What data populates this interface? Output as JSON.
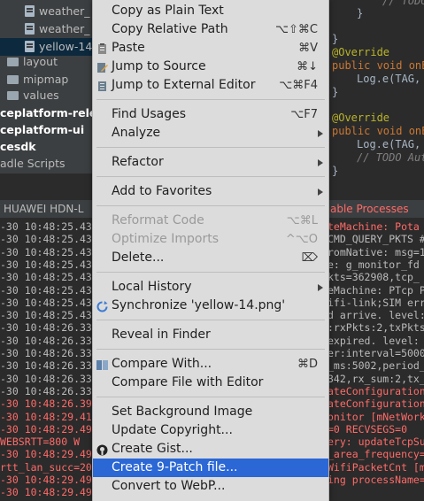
{
  "tree": {
    "items": [
      {
        "label": "weather_",
        "icon": "file-icon"
      },
      {
        "label": "weather_",
        "icon": "file-icon"
      },
      {
        "label": "yellow-14",
        "icon": "file-icon",
        "selected": true
      },
      {
        "label": "layout",
        "icon": "folder-icon"
      },
      {
        "label": "mipmap",
        "icon": "folder-icon"
      },
      {
        "label": "values",
        "icon": "folder-icon"
      },
      {
        "label": "ceplatform-rele",
        "icon": "module"
      },
      {
        "label": "ceplatform-ui",
        "icon": "module"
      },
      {
        "label": "cesdk",
        "icon": "module"
      },
      {
        "label": "adle Scripts",
        "icon": "gradle"
      }
    ]
  },
  "editor": {
    "lines": [
      {
        "text": "// TODO",
        "color": "#808080"
      },
      {
        "text": "}",
        "color": "#a9b7c6"
      },
      {
        "text": "}",
        "color": "#a9b7c6"
      },
      {
        "text": "@Override",
        "color": "#bbb529"
      },
      {
        "text": "public void onE",
        "color": "#cc7832"
      },
      {
        "text": "Log.e(TAG,",
        "color": "#a9b7c6"
      },
      {
        "text": "}",
        "color": "#a9b7c6"
      },
      {
        "text": "@Override",
        "color": "#bbb529"
      },
      {
        "text": "public void onE",
        "color": "#cc7832"
      },
      {
        "text": "Log.e(TAG,",
        "color": "#a9b7c6"
      },
      {
        "text": "// TODO Aut",
        "color": "#808080"
      },
      {
        "text": "}",
        "color": "#a9b7c6"
      }
    ]
  },
  "logcat": {
    "device": "HUAWEI HDN-L",
    "right_label": "able Processes",
    "left_lines": [
      "-30 10:48:25.43",
      "-30 10:48:25.43",
      "-30 10:48:25.43",
      "-30 10:48:25.43",
      "-30 10:48:25.43",
      "-30 10:48:25.43",
      "-30 10:48:25.43",
      "-30 10:48:25.43",
      "-30 10:48:26.33",
      "-30 10:48:26.33",
      "-30 10:48:26.33",
      "-30 10:48:26.33",
      "-30 10:48:26.33",
      "-30 10:48:26.33",
      "-30 10:48:26.39",
      "-30 10:48:29.41",
      "-30 10:48:29.49",
      "WEBSRTT=800  W",
      "-30 10:48:29.49",
      "rtt_lan_succ=20",
      "-30 10:48:29.49",
      "-30 10:48:29.49"
    ],
    "right_lines": [
      "teMachine: Pota",
      "CMD_QUERY_PKTS #",
      "romNative: msg=1",
      "e: g_monitor_fd",
      "kts=362908,tcp_",
      "eMachine: PTcp P",
      "ifi-link;SIM err",
      "d arrive. level:",
      ":rxPkts:2,txPkts",
      "expired. level:",
      "er:interval=5000",
      "_ms:5002,period_",
      "342,rx_sum:2,tx_",
      "ateConfiguration",
      "ateConfiguration",
      "onitor [mNetWork",
      "=0  RECVSEGS=0",
      "ery: updateTcpSu",
      "_area_frequency=",
      "WifiPacketCnt [m",
      "ing processName=",
      ""
    ]
  },
  "menu": {
    "items": [
      {
        "label": "Copy as Plain Text",
        "shortcut": "",
        "icon": "",
        "disabled": false,
        "submenu": false
      },
      {
        "label": "Copy Relative Path",
        "shortcut": "⌥⇧⌘C",
        "icon": "",
        "disabled": false,
        "submenu": false
      },
      {
        "label": "Paste",
        "shortcut": "⌘V",
        "icon": "paste-icon",
        "disabled": false,
        "submenu": false
      },
      {
        "label": "Jump to Source",
        "shortcut": "⌘↓",
        "icon": "edit-source-icon",
        "disabled": false,
        "submenu": false
      },
      {
        "label": "Jump to External Editor",
        "shortcut": "⌥⌘F4",
        "icon": "external-editor-icon",
        "disabled": false,
        "submenu": false
      },
      {
        "label": "Find Usages",
        "shortcut": "⌥F7",
        "icon": "",
        "disabled": false,
        "submenu": false
      },
      {
        "label": "Analyze",
        "shortcut": "",
        "icon": "",
        "disabled": false,
        "submenu": true
      },
      {
        "label": "Refactor",
        "shortcut": "",
        "icon": "",
        "disabled": false,
        "submenu": true
      },
      {
        "label": "Add to Favorites",
        "shortcut": "",
        "icon": "",
        "disabled": false,
        "submenu": true
      },
      {
        "label": "Reformat Code",
        "shortcut": "⌥⌘L",
        "icon": "",
        "disabled": true,
        "submenu": false
      },
      {
        "label": "Optimize Imports",
        "shortcut": "^⌥O",
        "icon": "",
        "disabled": true,
        "submenu": false
      },
      {
        "label": "Delete...",
        "shortcut": "⌦",
        "icon": "",
        "disabled": false,
        "submenu": false
      },
      {
        "label": "Local History",
        "shortcut": "",
        "icon": "",
        "disabled": false,
        "submenu": true
      },
      {
        "label": "Synchronize 'yellow-14.png'",
        "shortcut": "",
        "icon": "sync-icon",
        "disabled": false,
        "submenu": false
      },
      {
        "label": "Reveal in Finder",
        "shortcut": "",
        "icon": "",
        "disabled": false,
        "submenu": false
      },
      {
        "label": "Compare With...",
        "shortcut": "⌘D",
        "icon": "compare-icon",
        "disabled": false,
        "submenu": false
      },
      {
        "label": "Compare File with Editor",
        "shortcut": "",
        "icon": "",
        "disabled": false,
        "submenu": false
      },
      {
        "label": "Set Background Image",
        "shortcut": "",
        "icon": "",
        "disabled": false,
        "submenu": false
      },
      {
        "label": "Update Copyright...",
        "shortcut": "",
        "icon": "",
        "disabled": false,
        "submenu": false
      },
      {
        "label": "Create Gist...",
        "shortcut": "",
        "icon": "github-icon",
        "disabled": false,
        "submenu": false
      },
      {
        "label": "Create 9-Patch file...",
        "shortcut": "",
        "icon": "",
        "disabled": false,
        "submenu": false,
        "highlighted": true
      },
      {
        "label": "Convert to WebP...",
        "shortcut": "",
        "icon": "",
        "disabled": false,
        "submenu": false
      }
    ]
  },
  "colors": {
    "menu_bg": "#dcdcdc",
    "highlight": "#2b67d5",
    "log_red": "#ff6b68",
    "log_normal": "#bbbbbb"
  }
}
